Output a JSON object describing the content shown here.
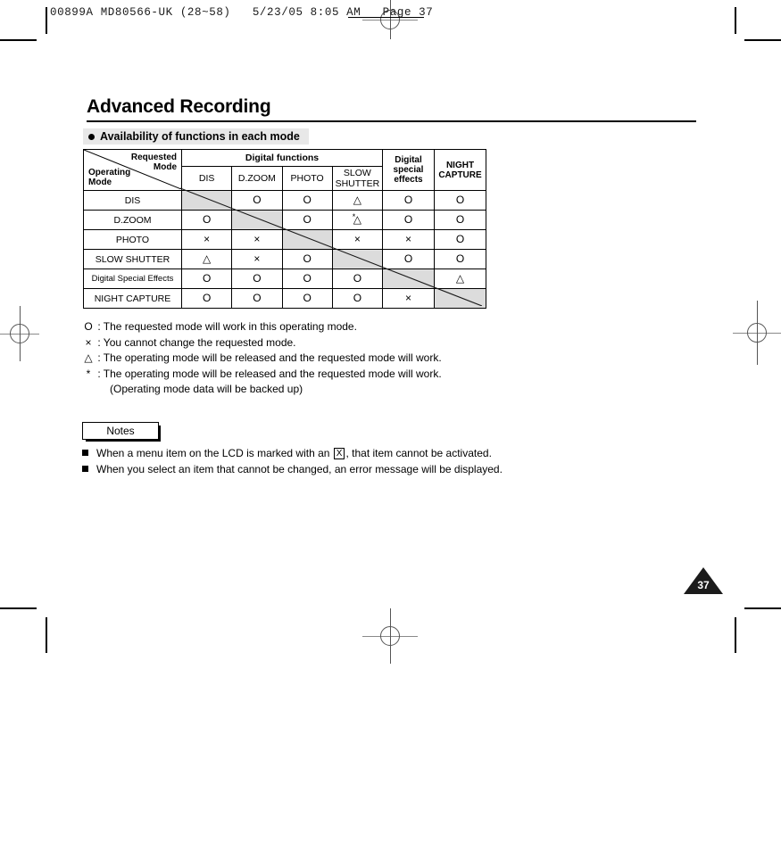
{
  "print_strip": {
    "text": "00899A MD80566-UK (28~58)   5/23/05 8:05 AM   Page 37"
  },
  "page": {
    "title": "Advanced Recording",
    "number": "37"
  },
  "section": {
    "heading": "Availability of functions in each mode"
  },
  "table": {
    "corner": {
      "requested": "Requested\nMode",
      "operating": "Operating\nMode"
    },
    "group_header": "Digital functions",
    "columns": [
      "DIS",
      "D.ZOOM",
      "PHOTO",
      "SLOW\nSHUTTER",
      "Digital\nspecial\neffects",
      "NIGHT\nCAPTURE"
    ],
    "rows": [
      {
        "label": "DIS",
        "cells": [
          "",
          "O",
          "O",
          "△",
          "O",
          "O"
        ],
        "diag_index": 0,
        "star_index": -1
      },
      {
        "label": "D.ZOOM",
        "cells": [
          "O",
          "",
          "O",
          "△",
          "O",
          "O"
        ],
        "diag_index": 1,
        "star_index": 3
      },
      {
        "label": "PHOTO",
        "cells": [
          "×",
          "×",
          "",
          "×",
          "×",
          "O"
        ],
        "diag_index": 2,
        "star_index": -1
      },
      {
        "label": "SLOW SHUTTER",
        "cells": [
          "△",
          "×",
          "O",
          "",
          "O",
          "O"
        ],
        "diag_index": 3,
        "star_index": -1
      },
      {
        "label": "Digital Special Effects",
        "cells": [
          "O",
          "O",
          "O",
          "O",
          "",
          "△"
        ],
        "diag_index": 4,
        "star_index": -1
      },
      {
        "label": "NIGHT CAPTURE",
        "cells": [
          "O",
          "O",
          "O",
          "O",
          "×",
          ""
        ],
        "diag_index": 5,
        "star_index": -1
      }
    ],
    "shaded_color": "#dcdcdc"
  },
  "legend": [
    {
      "symbol": "O",
      "text": ": The requested mode will work in this operating mode."
    },
    {
      "symbol": "×",
      "text": ": You cannot change the requested mode."
    },
    {
      "symbol": "△",
      "text": ": The operating mode will be released and the requested mode will work."
    },
    {
      "symbol": "*",
      "text": ": The operating mode will be released and the requested mode will work."
    }
  ],
  "legend_continuation": "(Operating mode data will be backed up)",
  "notes": {
    "label": "Notes",
    "items": [
      {
        "before": "When a menu item on the LCD is marked with an",
        "boxed": "X",
        "after": ", that item cannot be activated."
      },
      {
        "before": "When you select an item that cannot be changed, an error message will be displayed.",
        "boxed": "",
        "after": ""
      }
    ]
  }
}
